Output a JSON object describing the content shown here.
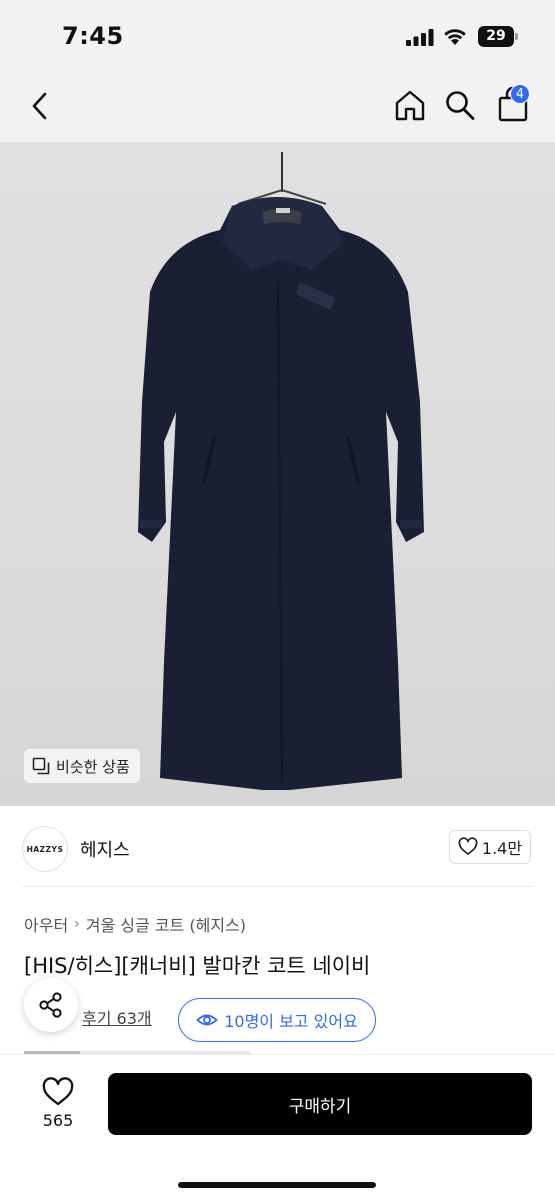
{
  "status": {
    "time": "7:45",
    "battery": "29"
  },
  "header": {
    "cart_count": "4"
  },
  "image": {
    "similar_label": "비슷한 상품"
  },
  "brand": {
    "logo_text": "HAZZYS",
    "name": "헤지스",
    "likes": "1.4만"
  },
  "product": {
    "breadcrumb": [
      "아우터",
      "겨울 싱글 코트 (헤지스)"
    ],
    "title": "[HIS/히스][캐너비] 발마칸 코트 네이비",
    "review_link": "후기 63개",
    "viewers": "10명이 보고 있어요"
  },
  "bottom": {
    "wish_count": "565",
    "buy_label": "구매하기"
  },
  "colors": {
    "accent": "#2f6bf2",
    "coat": "#1a1f33",
    "background": "#dcdcdc"
  }
}
